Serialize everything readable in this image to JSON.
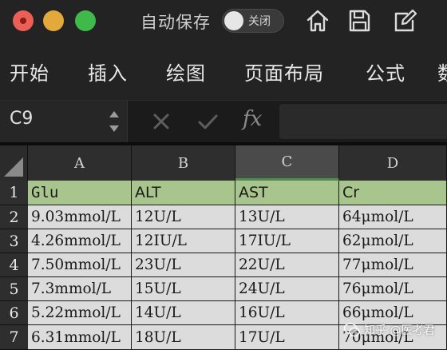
{
  "titlebar": {
    "autosave_label": "自动保存",
    "autosave_toggle": "关闭",
    "icons": [
      "home-icon",
      "save-icon",
      "edit-icon"
    ]
  },
  "ribbon": {
    "tabs": [
      "开始",
      "插入",
      "绘图",
      "页面布局",
      "公式",
      "数"
    ]
  },
  "formula_bar": {
    "name_box": "C9",
    "fx_label": "fx",
    "formula": ""
  },
  "sheet": {
    "columns": [
      "A",
      "B",
      "C",
      "D"
    ],
    "selected_column": "C",
    "rows": [
      "1",
      "2",
      "3",
      "4",
      "5",
      "6",
      "7"
    ],
    "header_row": [
      "Glu",
      "ALT",
      "AST",
      "Cr"
    ],
    "data": [
      [
        "9.03mmol/L",
        "12U/L",
        "13U/L",
        "64μmol/L"
      ],
      [
        "4.26mmol/L",
        "12IU/L",
        "17IU/L",
        "62μmol/L"
      ],
      [
        "7.50mmol/L",
        "23U/L",
        "22U/L",
        "77μmol/L"
      ],
      [
        "7.3mmol/L",
        "15U/L",
        "24U/L",
        "76μmol/L"
      ],
      [
        "5.22mmol/L",
        "14U/L",
        "16U/L",
        "66μmol/L"
      ],
      [
        "6.31mmol/L",
        "18U/L",
        "17U/L",
        "70μmol/L"
      ]
    ]
  },
  "watermark": "知乎 @医考君",
  "colors": {
    "header_fill": "#a9c58e",
    "cell_fill": "#dcdcdc",
    "selected_accent": "#4d8c4a"
  }
}
